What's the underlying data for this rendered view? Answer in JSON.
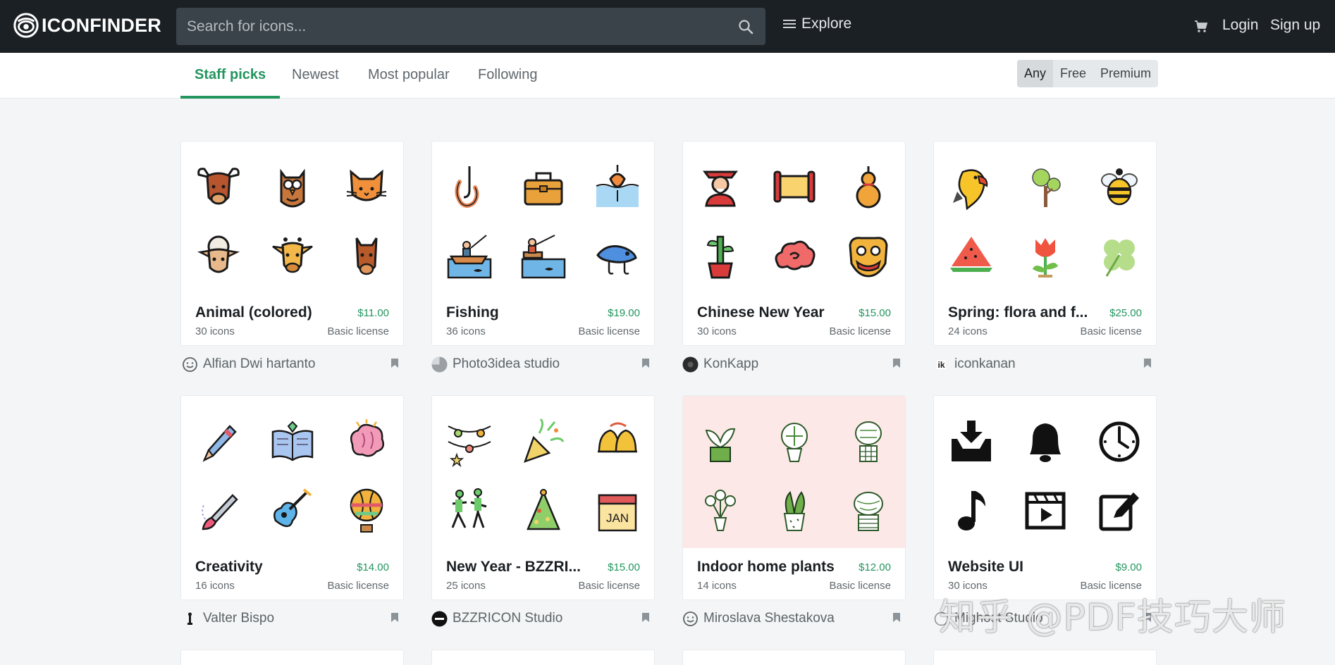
{
  "header": {
    "logo_text": "ICONFINDER",
    "search_placeholder": "Search for icons...",
    "explore_label": "Explore",
    "login_label": "Login",
    "signup_label": "Sign up"
  },
  "tabs": [
    "Staff picks",
    "Newest",
    "Most popular",
    "Following"
  ],
  "license_filter": {
    "options": [
      "Any",
      "Free",
      "Premium"
    ],
    "selected": "Any"
  },
  "cards": [
    {
      "title": "Animal (colored)",
      "price": "$11.00",
      "count": "30 icons",
      "license": "Basic license",
      "author": "Alfian Dwi hartanto"
    },
    {
      "title": "Fishing",
      "price": "$19.00",
      "count": "36 icons",
      "license": "Basic license",
      "author": "Photo3idea studio"
    },
    {
      "title": "Chinese New Year",
      "price": "$15.00",
      "count": "30 icons",
      "license": "Basic license",
      "author": "KonKapp"
    },
    {
      "title": "Spring: flora and f...",
      "price": "$25.00",
      "count": "24 icons",
      "license": "Basic license",
      "author": "iconkanan"
    },
    {
      "title": "Creativity",
      "price": "$14.00",
      "count": "16 icons",
      "license": "Basic license",
      "author": "Valter Bispo"
    },
    {
      "title": "New Year - BZZRI...",
      "price": "$15.00",
      "count": "25 icons",
      "license": "Basic license",
      "author": "BZZRICON Studio"
    },
    {
      "title": "Indoor home plants",
      "price": "$12.00",
      "count": "14 icons",
      "license": "Basic license",
      "author": "Miroslava Shestakova"
    },
    {
      "title": "Website UI",
      "price": "$9.00",
      "count": "30 icons",
      "license": "Basic license",
      "author": "Mighost Studio"
    }
  ],
  "watermark": "知乎 @PDF技巧大师",
  "colors": {
    "accent": "#23955f",
    "header_bg": "#1b2024",
    "search_bg": "#3b434a",
    "page_bg": "#f3f5f6",
    "plants_bg": "#fde8e8"
  }
}
